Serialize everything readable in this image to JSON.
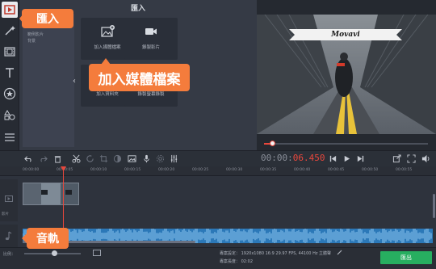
{
  "app": {
    "panel_title": "匯入",
    "accent_color": "#e8473c",
    "callout_color": "#f47c3c",
    "export_color": "#27ae60"
  },
  "tools": [
    {
      "name": "import-icon",
      "active": true
    },
    {
      "name": "magic-wand-icon"
    },
    {
      "name": "filmstrip-icon"
    },
    {
      "name": "text-icon"
    },
    {
      "name": "star-sticker-icon"
    },
    {
      "name": "shapes-icon"
    },
    {
      "name": "menu-list-icon"
    }
  ],
  "import": {
    "sub_nav": [
      "範例影片",
      "背景"
    ],
    "tiles": [
      {
        "label": "加入媒體檔案",
        "icon": "add-media-icon"
      },
      {
        "label": "錄製影片",
        "icon": "video-camera-icon"
      },
      {
        "label": "加入資料夾",
        "icon": "folder-icon"
      },
      {
        "label": "錄製螢幕錄製",
        "icon": "screen-record-icon"
      }
    ]
  },
  "preview": {
    "banner_text": "Movavi",
    "progress": 0.05
  },
  "time": {
    "gray": "00:00:",
    "red": "06.450"
  },
  "ruler_ticks": [
    "00:00:00",
    "00:00:05",
    "00:00:10",
    "00:00:15",
    "00:00:20",
    "00:00:25",
    "00:00:30",
    "00:00:35",
    "00:00:40",
    "00:00:45",
    "00:00:50",
    "00:00:55"
  ],
  "tracks": {
    "video_label": "影片",
    "audio_icon": "music-note-icon"
  },
  "bottom": {
    "scale_label": "比例：",
    "project_settings_label": "專案設定：",
    "project_settings_value": "1920x1080 16:9 29.97 FPS, 44100 Hz 立體聲",
    "project_length_label": "專案長度：",
    "project_length_value": "02:02",
    "export_label": "匯出"
  },
  "callouts": {
    "import": "匯入",
    "add_media": "加入媒體檔案",
    "audio_track": "音軌"
  }
}
